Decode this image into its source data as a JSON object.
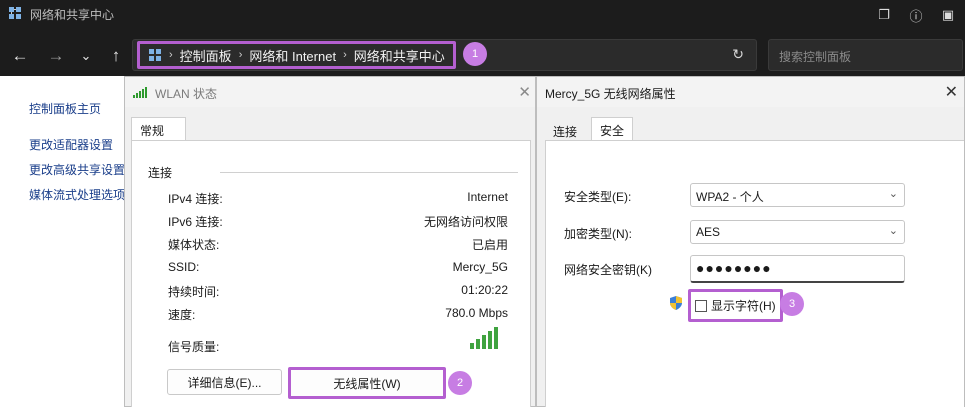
{
  "window": {
    "title": "网络和共享中心"
  },
  "address": {
    "crumbs": [
      "控制面板",
      "网络和 Internet",
      "网络和共享中心"
    ],
    "search_placeholder": "搜索控制面板"
  },
  "badges": [
    "1",
    "2",
    "3"
  ],
  "left_nav": {
    "items": [
      "控制面板主页",
      "更改适配器设置",
      "更改高级共享设置",
      "媒体流式处理选项"
    ]
  },
  "wlan_dialog": {
    "title": "WLAN 状态",
    "tab": "常规",
    "section": "连接",
    "rows": [
      {
        "label": "IPv4 连接:",
        "value": "Internet"
      },
      {
        "label": "IPv6 连接:",
        "value": "无网络访问权限"
      },
      {
        "label": "媒体状态:",
        "value": "已启用"
      },
      {
        "label": "SSID:",
        "value": "Mercy_5G"
      },
      {
        "label": "持续时间:",
        "value": "01:20:22"
      },
      {
        "label": "速度:",
        "value": "780.0 Mbps"
      }
    ],
    "signal_label": "信号质量:",
    "details_button": "详细信息(E)...",
    "wireless_props_button": "无线属性(W)"
  },
  "props_dialog": {
    "title": "Mercy_5G 无线网络属性",
    "tabs": [
      "连接",
      "安全"
    ],
    "active_tab": "安全",
    "security_type_label": "安全类型(E):",
    "security_type_value": "WPA2 - 个人",
    "encryption_type_label": "加密类型(N):",
    "encryption_type_value": "AES",
    "key_label": "网络安全密钥(K)",
    "key_value": "●●●●●●●●",
    "show_chars_label": "显示字符(H)"
  },
  "colors": {
    "highlight": "#b45fd0",
    "badge": "#c77de3",
    "titlebar": "#1c1c1c"
  }
}
